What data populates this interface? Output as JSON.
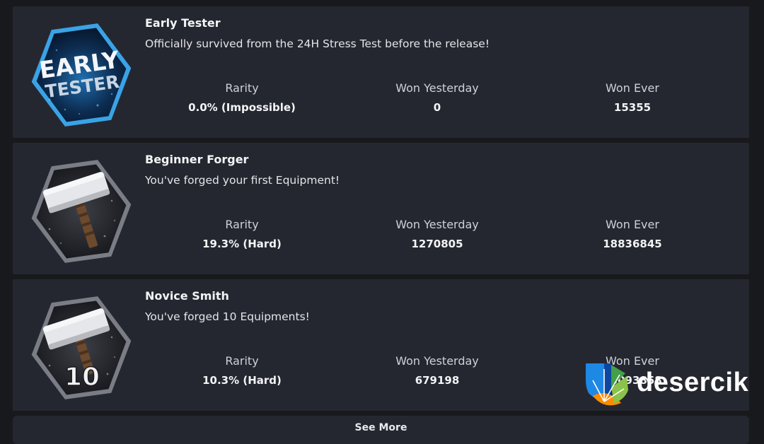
{
  "achievements": [
    {
      "title": "Early Tester",
      "description": "Officially survived from the 24H Stress Test before the release!",
      "badge_icon": "early-tester-badge-icon",
      "badge_text": [
        "EARLY",
        "TESTER"
      ],
      "stats": [
        {
          "label": "Rarity",
          "value": "0.0% (Impossible)"
        },
        {
          "label": "Won Yesterday",
          "value": "0"
        },
        {
          "label": "Won Ever",
          "value": "15355"
        }
      ]
    },
    {
      "title": "Beginner Forger",
      "description": "You've forged your first Equipment!",
      "badge_icon": "hammer-badge-icon",
      "stats": [
        {
          "label": "Rarity",
          "value": "19.3% (Hard)"
        },
        {
          "label": "Won Yesterday",
          "value": "1270805"
        },
        {
          "label": "Won Ever",
          "value": "18836845"
        }
      ]
    },
    {
      "title": "Novice Smith",
      "description": "You've forged 10 Equipments!",
      "badge_icon": "hammer-10-badge-icon",
      "badge_number": "10",
      "stats": [
        {
          "label": "Rarity",
          "value": "10.3% (Hard)"
        },
        {
          "label": "Won Yesterday",
          "value": "679198"
        },
        {
          "label": "Won Ever",
          "value": "18093858"
        }
      ]
    }
  ],
  "see_more_label": "See More",
  "watermark": {
    "text": "desercik",
    "icon": "desercik-logo-icon"
  },
  "colors": {
    "background": "#18191d",
    "card": "#252730",
    "text": "#f3f4f6",
    "label": "#cfd1d8",
    "badge_blue": "#2a8fd6"
  }
}
